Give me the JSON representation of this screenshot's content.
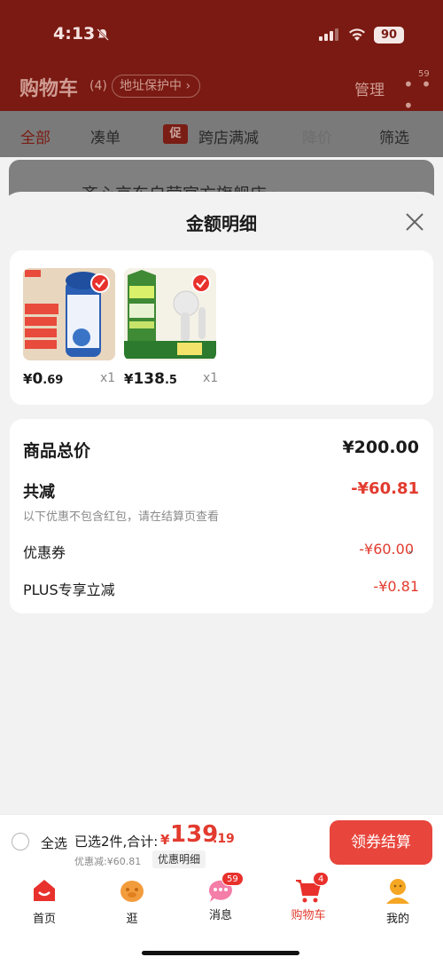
{
  "status_bar": {
    "time": "4:13",
    "battery": "90"
  },
  "background": {
    "cart_title": "购物车",
    "cart_count": "(4)",
    "address_protect": "地址保护中 ›",
    "manage": "管理",
    "more_badge": "59",
    "tabs": [
      "全部",
      "凑单",
      "跨店满减",
      "降价",
      "筛选"
    ],
    "promo_tag": "促",
    "store_name": "齐心京东自营官方旗舰店 ›"
  },
  "sheet": {
    "title": "金额明细",
    "products": [
      {
        "name": "液体胶水",
        "price_yen": "¥",
        "price_int": "0",
        "price_dec": ".69",
        "qty": "x1"
      },
      {
        "name": "DREAME 吹风机",
        "price_yen": "¥",
        "price_int": "138",
        "price_dec": ".5",
        "qty": "x1"
      }
    ],
    "breakdown": {
      "total_label": "商品总价",
      "total_value": "¥200.00",
      "reduce_label": "共减",
      "reduce_value": "-¥60.81",
      "note": "以下优惠不包含红包，请在结算页查看",
      "coupon_label": "优惠券",
      "coupon_value": "-¥60.00",
      "plus_label": "PLUS专享立减",
      "plus_value": "-¥0.81"
    }
  },
  "checkout": {
    "select_all": "全选",
    "selected_text": "已选2件,合计:",
    "sum_yen": "¥",
    "sum_int": "139",
    "sum_dec": ".19",
    "discount_text": "优惠减:¥60.81",
    "detail_tag": "优惠明细",
    "button": "领券结算"
  },
  "tabbar": {
    "items": [
      {
        "label": "首页",
        "icon": "home-icon",
        "active": false
      },
      {
        "label": "逛",
        "icon": "discover-icon",
        "active": false
      },
      {
        "label": "消息",
        "icon": "message-icon",
        "badge": "59",
        "active": false
      },
      {
        "label": "购物车",
        "icon": "cart-icon",
        "badge": "4",
        "active": true
      },
      {
        "label": "我的",
        "icon": "profile-icon",
        "active": false
      }
    ]
  },
  "colors": {
    "accent": "#e23b2e",
    "header_bg": "#7a1a12"
  }
}
